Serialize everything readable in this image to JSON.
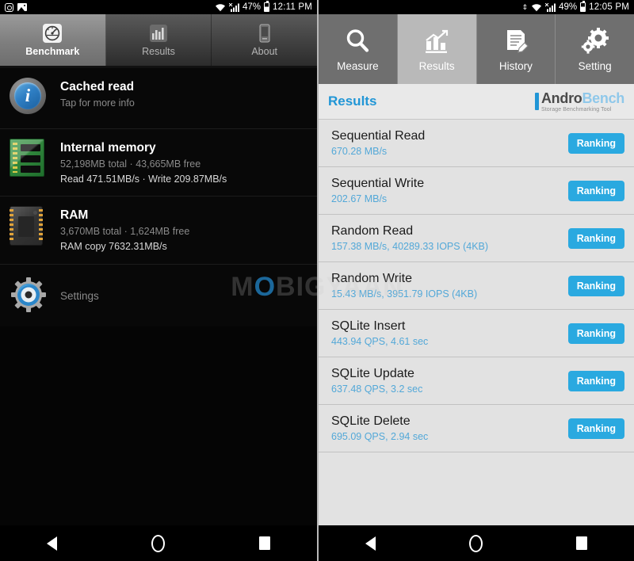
{
  "left_phone": {
    "status_bar": {
      "icons": [
        "instagram-icon",
        "screenshot-image-icon"
      ],
      "wifi": "wifi-icon",
      "signal": "cellular-signal-icon",
      "battery_percent": "47%",
      "battery": "battery-icon",
      "time": "12:11 PM"
    },
    "tabs": [
      {
        "label": "Benchmark",
        "icon": "speedometer-icon",
        "active": true
      },
      {
        "label": "Results",
        "icon": "bar-chart-icon",
        "active": false
      },
      {
        "label": "About",
        "icon": "phone-icon",
        "active": false
      }
    ],
    "items": [
      {
        "icon": "info-icon",
        "title": "Cached read",
        "sub": "Tap for more info",
        "sub2": ""
      },
      {
        "icon": "memory-stick-icon",
        "title": "Internal memory",
        "sub": "52,198MB total · 43,665MB free",
        "sub2": "Read 471.51MB/s · Write 209.87MB/s"
      },
      {
        "icon": "ram-chip-icon",
        "title": "RAM",
        "sub": "3,670MB total · 1,624MB free",
        "sub2": "RAM copy 7632.31MB/s"
      }
    ],
    "settings": {
      "icon": "gear-icon",
      "label": "Settings"
    }
  },
  "right_phone": {
    "status_bar": {
      "updown": "data-transfer-icon",
      "wifi": "wifi-icon",
      "signal": "cellular-signal-icon",
      "battery_percent": "49%",
      "battery": "battery-icon",
      "time": "12:05 PM"
    },
    "tabs": [
      {
        "label": "Measure",
        "icon": "magnifier-icon",
        "active": false
      },
      {
        "label": "Results",
        "icon": "bar-chart-icon",
        "active": true
      },
      {
        "label": "History",
        "icon": "document-pen-icon",
        "active": false
      },
      {
        "label": "Setting",
        "icon": "gears-icon",
        "active": false
      }
    ],
    "header": {
      "title": "Results",
      "logo_main_a": "Andro",
      "logo_main_b": "Bench",
      "logo_sub": "Storage Benchmarking Tool"
    },
    "rows": [
      {
        "title": "Sequential Read",
        "value": "670.28 MB/s",
        "button": "Ranking"
      },
      {
        "title": "Sequential Write",
        "value": "202.67 MB/s",
        "button": "Ranking"
      },
      {
        "title": "Random Read",
        "value": "157.38 MB/s, 40289.33 IOPS (4KB)",
        "button": "Ranking"
      },
      {
        "title": "Random Write",
        "value": "15.43 MB/s, 3951.79 IOPS (4KB)",
        "button": "Ranking"
      },
      {
        "title": "SQLite Insert",
        "value": "443.94 QPS, 4.61 sec",
        "button": "Ranking"
      },
      {
        "title": "SQLite Update",
        "value": "637.48 QPS, 3.2 sec",
        "button": "Ranking"
      },
      {
        "title": "SQLite Delete",
        "value": "695.09 QPS, 2.94 sec",
        "button": "Ranking"
      }
    ]
  },
  "nav_bar": {
    "back": "back-triangle-icon",
    "home": "home-circle-icon",
    "recent": "recent-square-icon"
  },
  "watermark": {
    "part1": "M",
    "part2": "O",
    "part3": "BIGYAAN"
  },
  "colors": {
    "accent_blue": "#2aa9e0",
    "value_blue": "#53a8d8",
    "light_bg": "#e2e2e2",
    "tab_gray": "#6f6f6f",
    "tab_active_gray": "#b9b9b9"
  }
}
